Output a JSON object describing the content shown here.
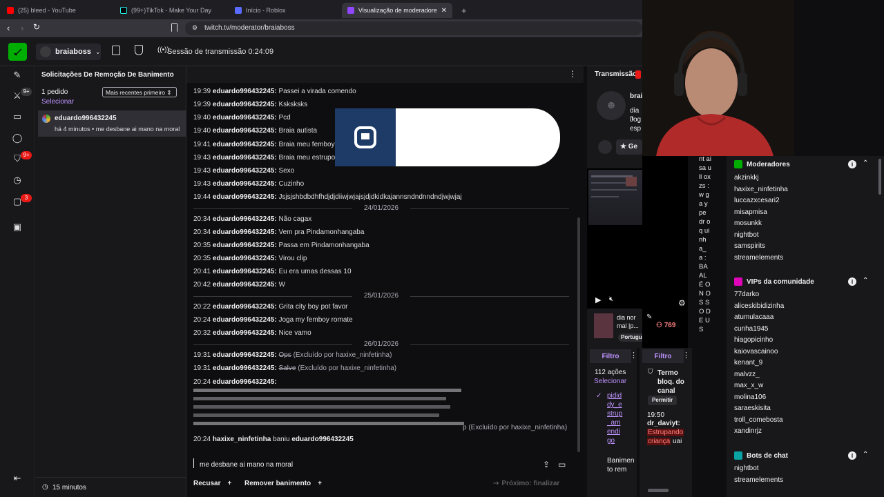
{
  "browser": {
    "tabs": [
      {
        "label": "(25) bleed - YouTube",
        "color": "#ff0000"
      },
      {
        "label": "(99+)TikTok - Make Your Day",
        "color": "#000000"
      },
      {
        "label": "Início - Roblox",
        "color": "#5a6cff"
      },
      {
        "label": "Visualização de moderadores de",
        "color": "#9146ff",
        "active": true
      }
    ],
    "url": "twitch.tv/moderator/braiaboss"
  },
  "topbar": {
    "channel": "braiaboss",
    "session_label": "Sessão de transmissão 0:24:09"
  },
  "rail_badges": {
    "b1": "9+",
    "b2": "9+",
    "b3": "3"
  },
  "unban": {
    "title": "Solicitações De Remoção De Banimento",
    "count": "1 pedido",
    "sort": "Mais recentes primeiro",
    "select": "Selecionar",
    "request_user": "eduardo996432245",
    "request_time": "há 4 minutos",
    "request_msg": "me desbane ai mano na moral",
    "footer_time": "15 minutos"
  },
  "chat": {
    "lines": [
      {
        "t": "19:39",
        "u": "eduardo996432245",
        "m": "Passei a virada comendo"
      },
      {
        "t": "19:39",
        "u": "eduardo996432245",
        "m": "Ksksksks"
      },
      {
        "t": "19:40",
        "u": "eduardo996432245",
        "m": "Pcd"
      },
      {
        "t": "19:40",
        "u": "eduardo996432245",
        "m": "Braia autista"
      },
      {
        "t": "19:41",
        "u": "eduardo996432245",
        "m": "Braia meu femboy"
      },
      {
        "t": "19:43",
        "u": "eduardo996432245",
        "m": "Braia meu estrupo"
      },
      {
        "t": "19:43",
        "u": "eduardo996432245",
        "m": "Sexo"
      },
      {
        "t": "19:43",
        "u": "eduardo996432245",
        "m": "Cuzinho"
      },
      {
        "t": "19:44",
        "u": "eduardo996432245",
        "m": "Jsjsjshbdbdhfhdjdjdiiwjwjajsjdjdkidkajannsndndnndndjwjwjaj"
      }
    ],
    "date1": "24/01/2026",
    "lines2": [
      {
        "t": "20:34",
        "u": "eduardo996432245",
        "m": "Não cagax"
      },
      {
        "t": "20:34",
        "u": "eduardo996432245",
        "m": "Vem pra Pindamonhangaba"
      },
      {
        "t": "20:35",
        "u": "eduardo996432245",
        "m": "Passa em Pindamonhangaba"
      },
      {
        "t": "20:35",
        "u": "eduardo996432245",
        "m": "Virou clip"
      },
      {
        "t": "20:41",
        "u": "eduardo996432245",
        "m": "Eu era umas dessas 10"
      },
      {
        "t": "20:42",
        "u": "eduardo996432245",
        "m": "W"
      }
    ],
    "date2": "25/01/2026",
    "lines3": [
      {
        "t": "20:22",
        "u": "eduardo996432245",
        "m": "Grita city boy pot favor"
      },
      {
        "t": "20:24",
        "u": "eduardo996432245",
        "m": "Joga my femboy romate"
      },
      {
        "t": "20:32",
        "u": "eduardo996432245",
        "m": "Nice vamo"
      }
    ],
    "date3": "26/01/2026",
    "del1": {
      "t": "19:31",
      "u": "eduardo996432245",
      "m": "Ops",
      "note": "(Excluído por haxixe_ninfetinha)"
    },
    "del2": {
      "t": "19:31",
      "u": "eduardo996432245",
      "m": "Salve",
      "note": "(Excluído por haxixe_ninfetinha)"
    },
    "ascii_head": {
      "t": "20:24",
      "u": "eduardo996432245"
    },
    "ascii_note": "p (Excluído por haxixe_ninfetinha)",
    "ban_line": {
      "t": "20:24",
      "u": "haxixe_ninfetinha",
      "action": "baniu",
      "target": "eduardo996432245"
    },
    "input": "me desbane ai mano na moral",
    "deny": "Recusar",
    "unban": "Remover banimento",
    "next": "Próximo: finalizar"
  },
  "stream_panel": {
    "title": "Transmissão",
    "streamer": "braia",
    "desc1": "dia n",
    "desc2": "Jog",
    "desc3": "esp",
    "follow": "Ge",
    "viewers": "769",
    "mini_title": "dia nor mal |p...",
    "lang": "Português"
  },
  "chat_strip": "nt ai sa ull ox zs : w ga y pe dr oq ui nh a_ a : BA AL É O N OS SO DE US",
  "actions_panel": {
    "filter": "Filtro",
    "count": "112 ações",
    "select": "Selecionar",
    "user": "pididdy_estrup_amendigo",
    "action": "Banimen to rem"
  },
  "terms_panel": {
    "filter": "Filtro",
    "title": "Termo bloq. do canal",
    "allow": "Permitir",
    "time": "19:50",
    "user": "dr_daviyt:",
    "msg1": "Estrupando",
    "msg2": "criança",
    "msg3": "uai"
  },
  "community": {
    "mods_title": "Moderadores",
    "mods": [
      "akzinkkj",
      "haxixe_ninfetinha",
      "luccazxcesari2",
      "misapmisa",
      "mosunkk",
      "nightbot",
      "samspirits",
      "streamelements"
    ],
    "vips_title": "VIPs da comunidade",
    "vips": [
      "77darko",
      "aliceskibidizinha",
      "atumulacaaa",
      "cunha1945",
      "hiagopicinho",
      "kaiovascainoo",
      "kenant_9",
      "malvzz_",
      "max_x_w",
      "molina106",
      "saraeskisita",
      "troll_comebosta",
      "xandinrjz"
    ],
    "bots_title": "Bots de chat",
    "bots": [
      "nightbot",
      "streamelements"
    ]
  },
  "colors": {
    "accent": "#bf94ff",
    "twitch": "#9146ff",
    "mod_green": "#00ad03",
    "vip_pink": "#e005b9",
    "bot_teal": "#0aa3a3",
    "danger": "#e91916"
  }
}
